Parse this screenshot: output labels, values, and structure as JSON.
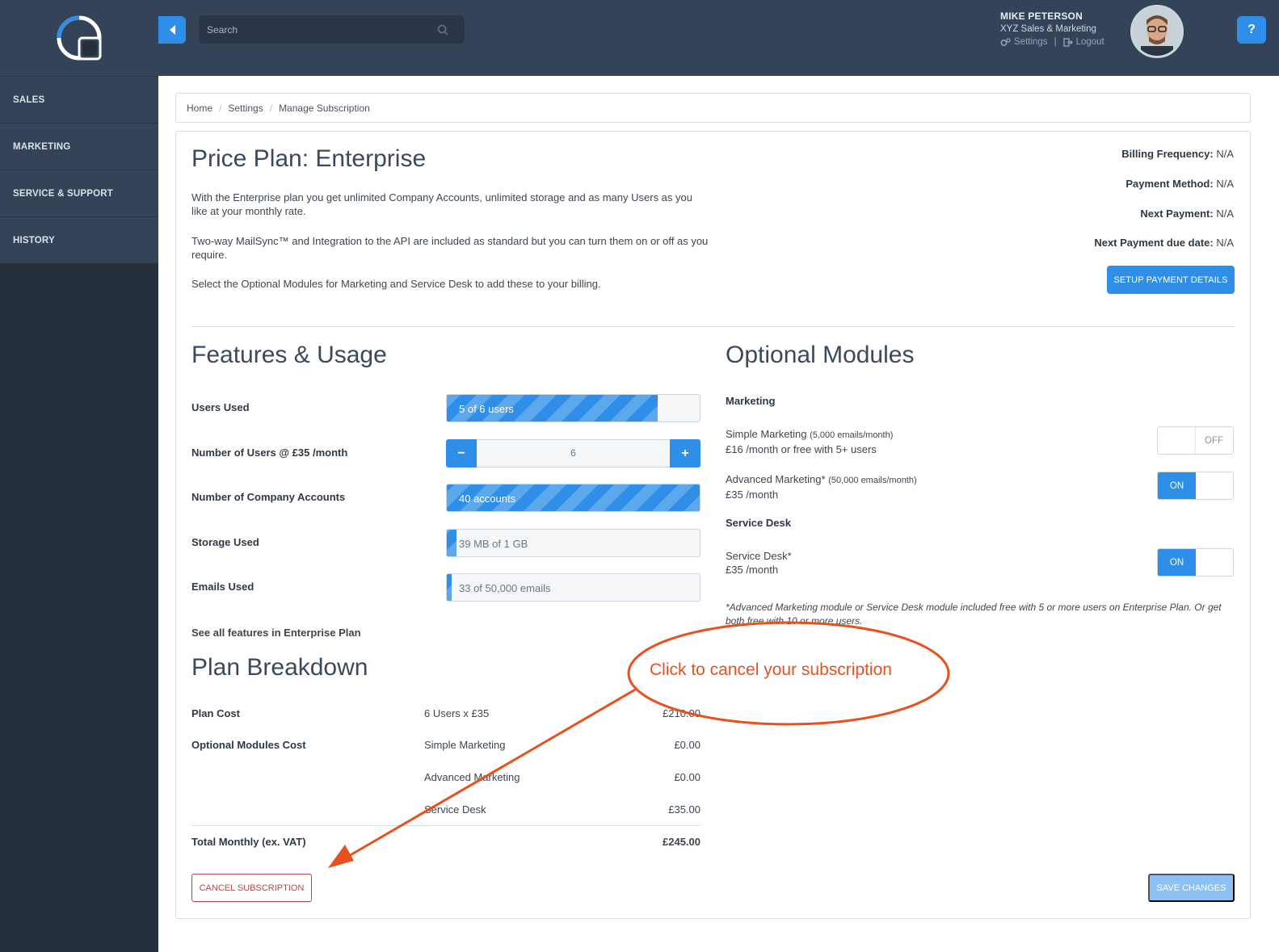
{
  "sidebar": {
    "items": [
      {
        "label": "SALES"
      },
      {
        "label": "MARKETING"
      },
      {
        "label": "SERVICE & SUPPORT"
      },
      {
        "label": "HISTORY"
      }
    ]
  },
  "topbar": {
    "search_placeholder": "Search",
    "user_name": "MIKE PETERSON",
    "user_company": "XYZ Sales & Marketing",
    "settings_label": "Settings",
    "links_separator": "|",
    "logout_label": "Logout",
    "help_label": "?"
  },
  "breadcrumb": {
    "items": [
      "Home",
      "Settings",
      "Manage Subscription"
    ],
    "separator": "/"
  },
  "plan": {
    "title": "Price Plan: Enterprise",
    "para1": "With the Enterprise plan you get unlimited Company Accounts, unlimited storage and as many Users as you like at your monthly rate.",
    "para2": "Two-way MailSync™ and Integration to the API are included as standard but you can turn them on or off as you require.",
    "para3": "Select the Optional Modules for Marketing and Service Desk to add these to your billing."
  },
  "billing": {
    "frequency_label": "Billing Frequency:",
    "frequency_value": "N/A",
    "method_label": "Payment Method:",
    "method_value": "N/A",
    "next_label": "Next Payment:",
    "next_value": "N/A",
    "due_label": "Next Payment due date:",
    "due_value": "N/A",
    "setup_button": "SETUP PAYMENT DETAILS"
  },
  "features": {
    "title": "Features & Usage",
    "users_used_label": "Users Used",
    "users_used_value": "5 of 6 users",
    "users_used_fraction": 0.833,
    "num_users_label": "Number of Users @ £35 /month",
    "num_users_value": "6",
    "minus_label": "−",
    "plus_label": "+",
    "accounts_label": "Number of Company Accounts",
    "accounts_value": "40 accounts",
    "accounts_fraction": 1.0,
    "storage_label": "Storage Used",
    "storage_value": "39 MB of 1 GB",
    "storage_fraction": 0.038,
    "emails_label": "Emails Used",
    "emails_value": "33 of 50,000 emails",
    "emails_fraction": 0.0007,
    "see_all_link": "See all features in Enterprise Plan"
  },
  "modules": {
    "title": "Optional Modules",
    "marketing_group": "Marketing",
    "simple_name": "Simple Marketing",
    "simple_quota": "(5,000 emails/month)",
    "simple_price": "£16 /month or free with 5+ users",
    "simple_state": "OFF",
    "advanced_name": "Advanced Marketing*",
    "advanced_quota": "(50,000 emails/month)",
    "advanced_price": "£35 /month",
    "advanced_state": "ON",
    "service_group": "Service Desk",
    "service_name": "Service Desk*",
    "service_price": "£35 /month",
    "service_state": "ON",
    "footnote": "*Advanced Marketing module or Service Desk module included free with 5 or more users on Enterprise Plan. Or get both free with 10 or more users."
  },
  "breakdown": {
    "title": "Plan Breakdown",
    "plan_cost_label": "Plan Cost",
    "plan_cost_item": "6 Users x £35",
    "plan_cost_value": "£210.00",
    "modules_cost_label": "Optional Modules Cost",
    "simple_item": "Simple Marketing",
    "simple_value": "£0.00",
    "advanced_item": "Advanced Marketing",
    "advanced_value": "£0.00",
    "service_item": "Service Desk",
    "service_value": "£35.00",
    "total_label": "Total Monthly (ex. VAT)",
    "total_value": "£245.00"
  },
  "actions": {
    "cancel_button": "CANCEL SUBSCRIPTION",
    "save_button": "SAVE CHANGES"
  },
  "annotation": {
    "text": "Click to cancel your subscription",
    "color": "#e8501f"
  },
  "colors": {
    "accent": "#2f8fe8",
    "sidebar": "#26303d",
    "topbar": "#354358",
    "cancel": "#b04a4a"
  }
}
